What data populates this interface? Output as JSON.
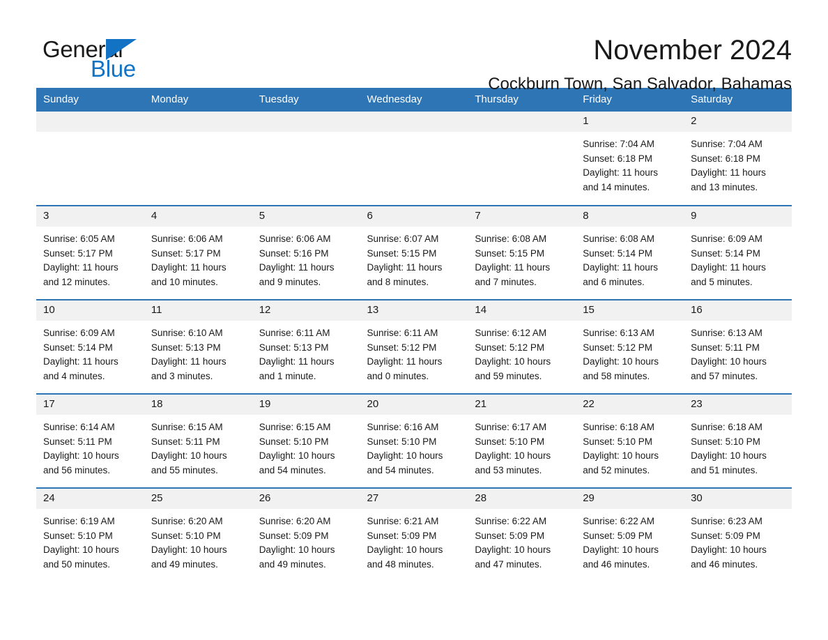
{
  "logo": {
    "word1": "General",
    "word2": "Blue",
    "triangle_icon": "triangle-icon",
    "accent_color": "#1273c4"
  },
  "header": {
    "title": "November 2024",
    "location": "Cockburn Town, San Salvador, Bahamas"
  },
  "theme": {
    "header_blue": "#2e75b6",
    "daynum_gray": "#f1f1f1",
    "text": "#1a1a1a"
  },
  "weekday_headers": [
    "Sunday",
    "Monday",
    "Tuesday",
    "Wednesday",
    "Thursday",
    "Friday",
    "Saturday"
  ],
  "weeks": [
    [
      {
        "day": "",
        "blank": true
      },
      {
        "day": "",
        "blank": true
      },
      {
        "day": "",
        "blank": true
      },
      {
        "day": "",
        "blank": true
      },
      {
        "day": "",
        "blank": true
      },
      {
        "day": "1",
        "sunrise": "Sunrise: 7:04 AM",
        "sunset": "Sunset: 6:18 PM",
        "daylight1": "Daylight: 11 hours",
        "daylight2": "and 14 minutes."
      },
      {
        "day": "2",
        "sunrise": "Sunrise: 7:04 AM",
        "sunset": "Sunset: 6:18 PM",
        "daylight1": "Daylight: 11 hours",
        "daylight2": "and 13 minutes."
      }
    ],
    [
      {
        "day": "3",
        "sunrise": "Sunrise: 6:05 AM",
        "sunset": "Sunset: 5:17 PM",
        "daylight1": "Daylight: 11 hours",
        "daylight2": "and 12 minutes."
      },
      {
        "day": "4",
        "sunrise": "Sunrise: 6:06 AM",
        "sunset": "Sunset: 5:17 PM",
        "daylight1": "Daylight: 11 hours",
        "daylight2": "and 10 minutes."
      },
      {
        "day": "5",
        "sunrise": "Sunrise: 6:06 AM",
        "sunset": "Sunset: 5:16 PM",
        "daylight1": "Daylight: 11 hours",
        "daylight2": "and 9 minutes."
      },
      {
        "day": "6",
        "sunrise": "Sunrise: 6:07 AM",
        "sunset": "Sunset: 5:15 PM",
        "daylight1": "Daylight: 11 hours",
        "daylight2": "and 8 minutes."
      },
      {
        "day": "7",
        "sunrise": "Sunrise: 6:08 AM",
        "sunset": "Sunset: 5:15 PM",
        "daylight1": "Daylight: 11 hours",
        "daylight2": "and 7 minutes."
      },
      {
        "day": "8",
        "sunrise": "Sunrise: 6:08 AM",
        "sunset": "Sunset: 5:14 PM",
        "daylight1": "Daylight: 11 hours",
        "daylight2": "and 6 minutes."
      },
      {
        "day": "9",
        "sunrise": "Sunrise: 6:09 AM",
        "sunset": "Sunset: 5:14 PM",
        "daylight1": "Daylight: 11 hours",
        "daylight2": "and 5 minutes."
      }
    ],
    [
      {
        "day": "10",
        "sunrise": "Sunrise: 6:09 AM",
        "sunset": "Sunset: 5:14 PM",
        "daylight1": "Daylight: 11 hours",
        "daylight2": "and 4 minutes."
      },
      {
        "day": "11",
        "sunrise": "Sunrise: 6:10 AM",
        "sunset": "Sunset: 5:13 PM",
        "daylight1": "Daylight: 11 hours",
        "daylight2": "and 3 minutes."
      },
      {
        "day": "12",
        "sunrise": "Sunrise: 6:11 AM",
        "sunset": "Sunset: 5:13 PM",
        "daylight1": "Daylight: 11 hours",
        "daylight2": "and 1 minute."
      },
      {
        "day": "13",
        "sunrise": "Sunrise: 6:11 AM",
        "sunset": "Sunset: 5:12 PM",
        "daylight1": "Daylight: 11 hours",
        "daylight2": "and 0 minutes."
      },
      {
        "day": "14",
        "sunrise": "Sunrise: 6:12 AM",
        "sunset": "Sunset: 5:12 PM",
        "daylight1": "Daylight: 10 hours",
        "daylight2": "and 59 minutes."
      },
      {
        "day": "15",
        "sunrise": "Sunrise: 6:13 AM",
        "sunset": "Sunset: 5:12 PM",
        "daylight1": "Daylight: 10 hours",
        "daylight2": "and 58 minutes."
      },
      {
        "day": "16",
        "sunrise": "Sunrise: 6:13 AM",
        "sunset": "Sunset: 5:11 PM",
        "daylight1": "Daylight: 10 hours",
        "daylight2": "and 57 minutes."
      }
    ],
    [
      {
        "day": "17",
        "sunrise": "Sunrise: 6:14 AM",
        "sunset": "Sunset: 5:11 PM",
        "daylight1": "Daylight: 10 hours",
        "daylight2": "and 56 minutes."
      },
      {
        "day": "18",
        "sunrise": "Sunrise: 6:15 AM",
        "sunset": "Sunset: 5:11 PM",
        "daylight1": "Daylight: 10 hours",
        "daylight2": "and 55 minutes."
      },
      {
        "day": "19",
        "sunrise": "Sunrise: 6:15 AM",
        "sunset": "Sunset: 5:10 PM",
        "daylight1": "Daylight: 10 hours",
        "daylight2": "and 54 minutes."
      },
      {
        "day": "20",
        "sunrise": "Sunrise: 6:16 AM",
        "sunset": "Sunset: 5:10 PM",
        "daylight1": "Daylight: 10 hours",
        "daylight2": "and 54 minutes."
      },
      {
        "day": "21",
        "sunrise": "Sunrise: 6:17 AM",
        "sunset": "Sunset: 5:10 PM",
        "daylight1": "Daylight: 10 hours",
        "daylight2": "and 53 minutes."
      },
      {
        "day": "22",
        "sunrise": "Sunrise: 6:18 AM",
        "sunset": "Sunset: 5:10 PM",
        "daylight1": "Daylight: 10 hours",
        "daylight2": "and 52 minutes."
      },
      {
        "day": "23",
        "sunrise": "Sunrise: 6:18 AM",
        "sunset": "Sunset: 5:10 PM",
        "daylight1": "Daylight: 10 hours",
        "daylight2": "and 51 minutes."
      }
    ],
    [
      {
        "day": "24",
        "sunrise": "Sunrise: 6:19 AM",
        "sunset": "Sunset: 5:10 PM",
        "daylight1": "Daylight: 10 hours",
        "daylight2": "and 50 minutes."
      },
      {
        "day": "25",
        "sunrise": "Sunrise: 6:20 AM",
        "sunset": "Sunset: 5:10 PM",
        "daylight1": "Daylight: 10 hours",
        "daylight2": "and 49 minutes."
      },
      {
        "day": "26",
        "sunrise": "Sunrise: 6:20 AM",
        "sunset": "Sunset: 5:09 PM",
        "daylight1": "Daylight: 10 hours",
        "daylight2": "and 49 minutes."
      },
      {
        "day": "27",
        "sunrise": "Sunrise: 6:21 AM",
        "sunset": "Sunset: 5:09 PM",
        "daylight1": "Daylight: 10 hours",
        "daylight2": "and 48 minutes."
      },
      {
        "day": "28",
        "sunrise": "Sunrise: 6:22 AM",
        "sunset": "Sunset: 5:09 PM",
        "daylight1": "Daylight: 10 hours",
        "daylight2": "and 47 minutes."
      },
      {
        "day": "29",
        "sunrise": "Sunrise: 6:22 AM",
        "sunset": "Sunset: 5:09 PM",
        "daylight1": "Daylight: 10 hours",
        "daylight2": "and 46 minutes."
      },
      {
        "day": "30",
        "sunrise": "Sunrise: 6:23 AM",
        "sunset": "Sunset: 5:09 PM",
        "daylight1": "Daylight: 10 hours",
        "daylight2": "and 46 minutes."
      }
    ]
  ]
}
